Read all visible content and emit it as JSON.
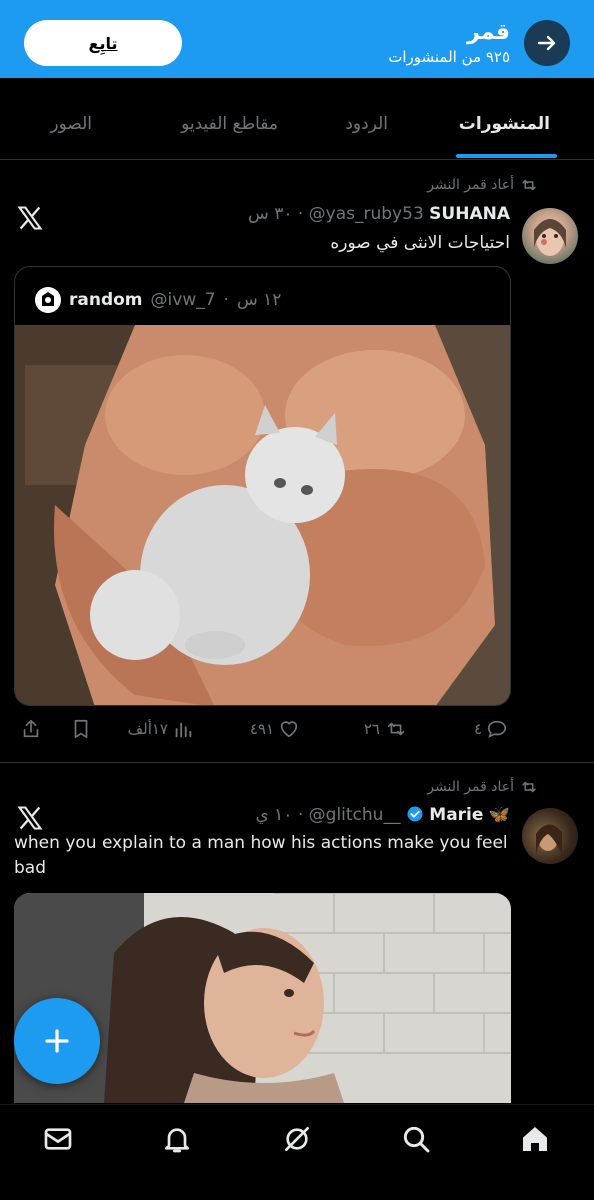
{
  "header": {
    "title": "قمر",
    "subtitle": "٩٢٥ من المنشورات",
    "follow_label": "تابِع",
    "back_icon": "arrow-right-icon"
  },
  "tabs": [
    {
      "label": "المنشورات",
      "active": true
    },
    {
      "label": "الردود",
      "active": false
    },
    {
      "label": "مقاطع الفيديو",
      "active": false
    },
    {
      "label": "الصور",
      "active": false
    }
  ],
  "tweets": [
    {
      "repost_text": "أعاد قمر النشر",
      "name": "SUHANA",
      "handle": "@yas_ruby53",
      "time": "٣٠ س",
      "text": "احتياجات الانثى في صوره",
      "quote": {
        "name": "random",
        "handle": "@ivw_7",
        "time": "١٢ س"
      },
      "stats": {
        "replies": "٤",
        "reposts": "٢٦",
        "likes": "٤٩١",
        "views": "١٧ألف"
      }
    },
    {
      "repost_text": "أعاد قمر النشر",
      "name": "Marie",
      "name_emoji": "🦋",
      "handle": "@glitchu__",
      "time": "١٠ ي",
      "text": "when you explain to a man how his actions make you feel bad"
    }
  ],
  "colors": {
    "accent": "#1d9bf0",
    "background": "#000000",
    "muted": "#71767b",
    "divider": "#2f3336"
  },
  "bottom_nav": [
    "home-icon",
    "search-icon",
    "grok-icon",
    "notifications-icon",
    "messages-icon"
  ],
  "fab_icon": "plus-icon"
}
